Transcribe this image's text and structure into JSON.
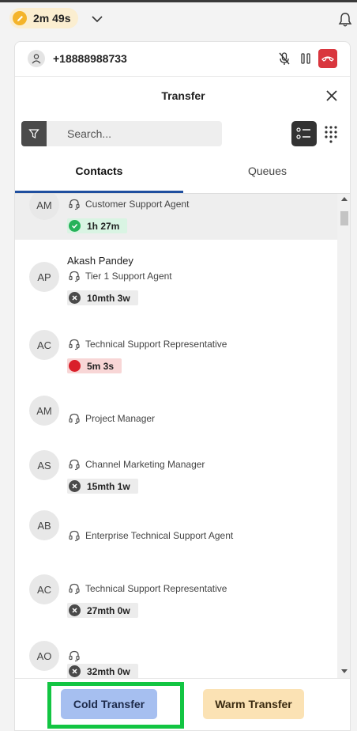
{
  "topbar": {
    "timer": "2m 49s",
    "icons": {
      "timer": "pencil-edit-icon",
      "dropdown": "chevron-down-icon",
      "notifications": "bell-icon"
    }
  },
  "call": {
    "number": "+18888988733",
    "icons": {
      "caller": "user-icon",
      "mute": "mic-off-icon",
      "hold": "pause-icon",
      "hangup": "phone-hangup-icon"
    }
  },
  "panel": {
    "title": "Transfer",
    "close_icon": "close-icon"
  },
  "search": {
    "placeholder": "Search...",
    "filter_icon": "filter-icon",
    "list_icon": "list-view-icon",
    "dialpad_icon": "dialpad-icon"
  },
  "tabs": [
    {
      "label": "Contacts",
      "active": true
    },
    {
      "label": "Queues",
      "active": false
    }
  ],
  "contacts": [
    {
      "initials": "AM",
      "name": "",
      "role": "Customer Support Agent",
      "status": "available",
      "duration": "1h 27m"
    },
    {
      "initials": "AP",
      "name": "Akash Pandey",
      "role": "Tier 1 Support Agent",
      "status": "offline",
      "duration": "10mth 3w"
    },
    {
      "initials": "AC",
      "name": "",
      "role": "Technical Support Representative",
      "status": "busy",
      "duration": "5m 3s"
    },
    {
      "initials": "AM",
      "name": "",
      "role": "Project Manager",
      "status": "",
      "duration": ""
    },
    {
      "initials": "AS",
      "name": "",
      "role": "Channel Marketing Manager",
      "status": "offline",
      "duration": "15mth 1w"
    },
    {
      "initials": "AB",
      "name": "",
      "role": "Enterprise Technical Support Agent",
      "status": "",
      "duration": ""
    },
    {
      "initials": "AC",
      "name": "",
      "role": "Technical Support Representative",
      "status": "offline",
      "duration": "27mth 0w"
    },
    {
      "initials": "AO",
      "name": "",
      "role": "",
      "status": "offline",
      "duration": "32mth 0w"
    }
  ],
  "footer": {
    "cold_label": "Cold Transfer",
    "warm_label": "Warm Transfer"
  },
  "colors": {
    "accent": "#1f4f9f",
    "focus_outline": "#12c542",
    "hangup": "#d9363e",
    "available": "#27b25a",
    "busy": "#d91f2a",
    "offline": "#4a4a4a",
    "cold_button": "#a6bff0",
    "warm_button": "#fbe2b4"
  }
}
